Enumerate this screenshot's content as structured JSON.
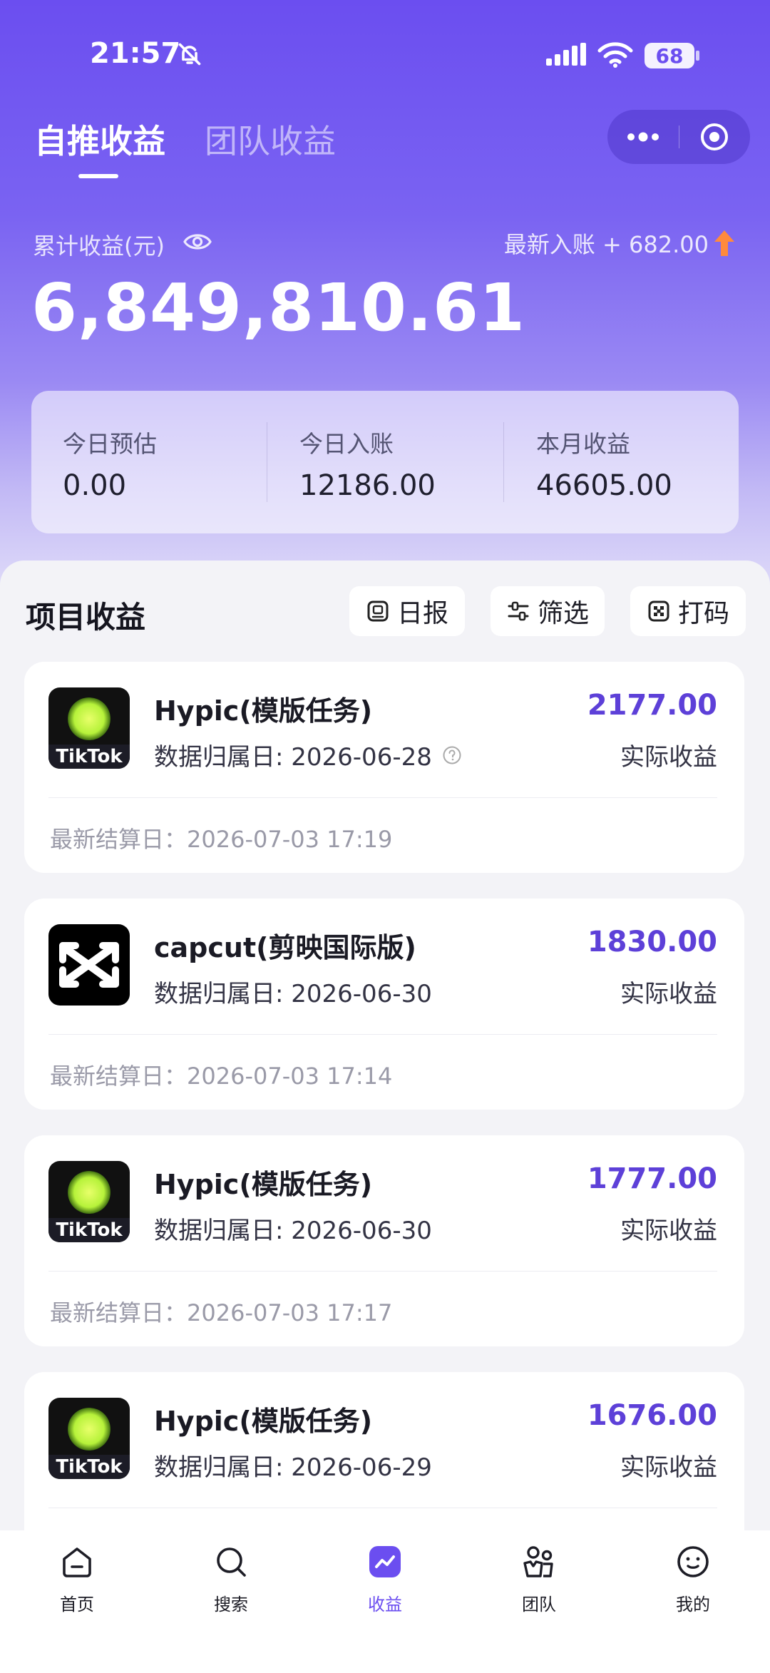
{
  "status_bar": {
    "time": "21:57",
    "battery": "68"
  },
  "tabs": {
    "active": "自推收益",
    "inactive": "团队收益"
  },
  "summary": {
    "total_label": "累计收益(元)",
    "total_amount": "6,849,810.61",
    "latest_label": "最新入账 + 682.00",
    "stats": [
      {
        "label": "今日预估",
        "value": "0.00"
      },
      {
        "label": "今日入账",
        "value": "12186.00"
      },
      {
        "label": "本月收益",
        "value": "46605.00"
      }
    ]
  },
  "section": {
    "title": "项目收益",
    "buttons": {
      "daily": "日报",
      "filter": "筛选",
      "code": "打码"
    }
  },
  "cards": [
    {
      "name": "Hypic(模版任务)",
      "date": "数据归属日: 2026-06-28",
      "amount": "2177.00",
      "amount_label": "实际收益",
      "settle": "最新结算日：2026-07-03 17:19",
      "logo": "TikTok"
    },
    {
      "name": "capcut(剪映国际版)",
      "date": "数据归属日: 2026-06-30",
      "amount": "1830.00",
      "amount_label": "实际收益",
      "settle": "最新结算日：2026-07-03 17:14",
      "logo": "capcut-icon"
    },
    {
      "name": "Hypic(模版任务)",
      "date": "数据归属日: 2026-06-30",
      "amount": "1777.00",
      "amount_label": "实际收益",
      "settle": "最新结算日：2026-07-03 17:17",
      "logo": "TikTok"
    },
    {
      "name": "Hypic(模版任务)",
      "date": "数据归属日: 2026-06-29",
      "amount": "1676.00",
      "amount_label": "实际收益",
      "logo": "TikTok"
    }
  ],
  "nav": [
    {
      "label": "首页",
      "icon": "home-icon"
    },
    {
      "label": "搜索",
      "icon": "search-icon"
    },
    {
      "label": "收益",
      "icon": "earnings-icon"
    },
    {
      "label": "团队",
      "icon": "team-icon"
    },
    {
      "label": "我的",
      "icon": "profile-icon"
    }
  ],
  "colors": {
    "accent": "#6b4ef0",
    "amount": "#5d40d8"
  }
}
